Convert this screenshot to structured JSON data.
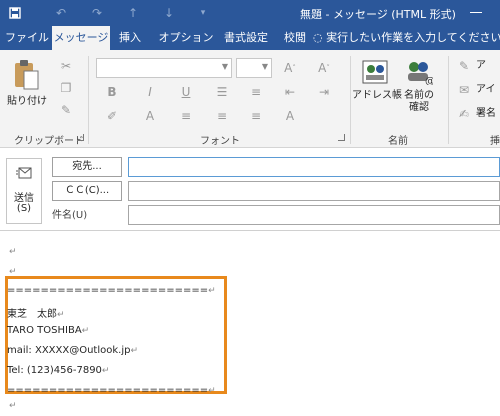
{
  "window": {
    "title": "無題 - メッセージ (HTML 形式)"
  },
  "tabs": [
    {
      "label": "ファイル"
    },
    {
      "label": "メッセージ"
    },
    {
      "label": "挿入"
    },
    {
      "label": "オプション"
    },
    {
      "label": "書式設定"
    },
    {
      "label": "校閲"
    }
  ],
  "tell_me": "実行したい作業を入力してください",
  "ribbon": {
    "paste_label": "貼り付け",
    "clipboard_label": "クリップボード",
    "font_label": "フォント",
    "address_book_label": "アドレス帳",
    "check_names_label_1": "名前の",
    "check_names_label_2": "確認",
    "names_group_label": "名前",
    "attach_cut_1": "ア",
    "attach_cut_2": "アイ",
    "attach_cut_3": "署名",
    "group_cut": "挿"
  },
  "compose": {
    "send_label_1": "送信",
    "send_label_2": "(S)",
    "to_button": "宛先...",
    "cc_button": "ＣＣ(C)...",
    "subject_label": "件名(U)",
    "to_value": "",
    "cc_value": "",
    "subject_value": ""
  },
  "body": {
    "pm": "↵",
    "signature": [
      "========================",
      "東芝　太郎",
      "TARO TOSHIBA",
      "mail: XXXXX@Outlook.jp",
      "Tel: (123)456-7890",
      "========================"
    ]
  }
}
